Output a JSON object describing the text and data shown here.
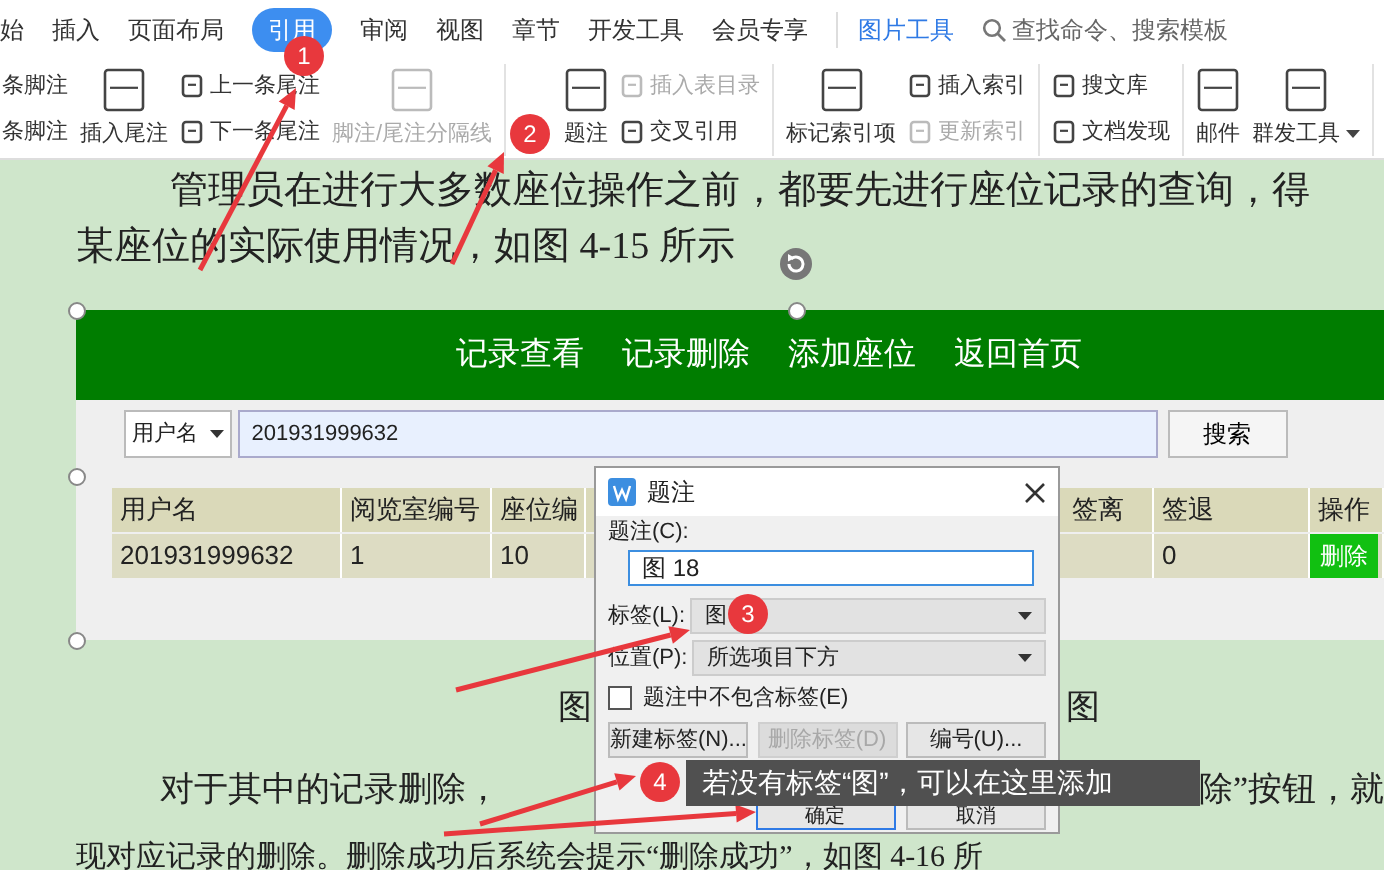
{
  "ribbon_tabs": [
    {
      "label": "始",
      "selected": false
    },
    {
      "label": "插入",
      "selected": false
    },
    {
      "label": "页面布局",
      "selected": false
    },
    {
      "label": "引用",
      "selected": true
    },
    {
      "label": "审阅",
      "selected": false
    },
    {
      "label": "视图",
      "selected": false
    },
    {
      "label": "章节",
      "selected": false
    },
    {
      "label": "开发工具",
      "selected": false
    },
    {
      "label": "会员专享",
      "selected": false
    }
  ],
  "context_tab": "图片工具",
  "search": {
    "placeholder": "查找命令、搜索模板"
  },
  "toolbar_groups": [
    [
      {
        "kind": "stack",
        "items": [
          {
            "label": "条脚注",
            "disabled": false
          },
          {
            "label": "条脚注",
            "disabled": false
          }
        ]
      },
      {
        "kind": "large",
        "label": "插入尾注",
        "disabled": false,
        "dropdown": false
      },
      {
        "kind": "stack",
        "items": [
          {
            "label": "上一条尾注",
            "disabled": false
          },
          {
            "label": "下一条尾注",
            "disabled": false
          }
        ]
      },
      {
        "kind": "large",
        "label": "脚注/尾注分隔线",
        "disabled": true,
        "dropdown": false
      }
    ],
    [
      {
        "kind": "large",
        "label": "题注",
        "disabled": false,
        "dropdown": false
      },
      {
        "kind": "stack",
        "items": [
          {
            "label": "插入表目录",
            "disabled": true
          },
          {
            "label": "交叉引用",
            "disabled": false
          }
        ]
      }
    ],
    [
      {
        "kind": "large",
        "label": "标记索引项",
        "disabled": false,
        "dropdown": false
      },
      {
        "kind": "stack",
        "items": [
          {
            "label": "插入索引",
            "disabled": false
          },
          {
            "label": "更新索引",
            "disabled": true
          }
        ]
      }
    ],
    [
      {
        "kind": "stack",
        "items": [
          {
            "label": "搜文库",
            "disabled": false
          },
          {
            "label": "文档发现",
            "disabled": false
          }
        ]
      }
    ],
    [
      {
        "kind": "large",
        "label": "邮件",
        "disabled": false,
        "dropdown": false
      },
      {
        "kind": "large",
        "label": "群发工具",
        "disabled": false,
        "dropdown": true
      }
    ]
  ],
  "document": {
    "paragraph_1": "管理员在进行大多数座位操作之前，都要先进行座位记录的查询，得",
    "paragraph_2": "某座位的实际使用情况，如图 4-15 所示",
    "figure": {
      "nav": [
        "记录查看",
        "记录删除",
        "添加座位",
        "返回首页"
      ],
      "filter": {
        "select": "用户名",
        "value": "201931999632",
        "button": "搜索"
      },
      "columns": [
        {
          "header": "用户名",
          "cells": [
            {
              "kind": "text",
              "text": "201931999632"
            }
          ]
        },
        {
          "header": "阅览室编号",
          "cells": [
            {
              "kind": "text",
              "text": "1"
            }
          ]
        },
        {
          "header": "座位编",
          "cells": [
            {
              "kind": "text",
              "text": "10"
            }
          ]
        },
        {
          "header": "签离"
        },
        {
          "header": "签退",
          "cells": [
            {
              "kind": "text",
              "text": "0"
            }
          ]
        },
        {
          "header": "操作",
          "cells": [
            {
              "kind": "button",
              "text": "删除"
            }
          ]
        }
      ]
    },
    "caption": {
      "left": "图",
      "right": "图"
    },
    "paragraph_3": {
      "left": "对于其中的记录删除，",
      "right": "除”按钮，就"
    },
    "paragraph_4": "现对应记录的删除。删除成功后系统会提示“删除成功”，如图 4-16 所"
  },
  "dialog": {
    "title": "题注",
    "caption_label": "题注(C):",
    "caption_value": "图 18",
    "label_field": {
      "label": "标签(L):",
      "value": "图"
    },
    "position_field": {
      "label": "位置(P):",
      "value": "所选项目下方"
    },
    "exclude_label": {
      "label": "题注中不包含标签(E)",
      "checked": false
    },
    "buttons": [
      {
        "label": "新建标签(N)...",
        "disabled": false,
        "default": false
      },
      {
        "label": "删除标签(D)",
        "disabled": true,
        "default": false
      },
      {
        "label": "编号(U)...",
        "disabled": false,
        "default": false
      },
      {
        "label": "确定",
        "disabled": false,
        "default": true
      },
      {
        "label": "取消",
        "disabled": false,
        "default": false
      }
    ]
  },
  "markers": [
    "1",
    "2",
    "3",
    "4"
  ],
  "tooltip": "若没有标签“图”，可以在这里添加"
}
